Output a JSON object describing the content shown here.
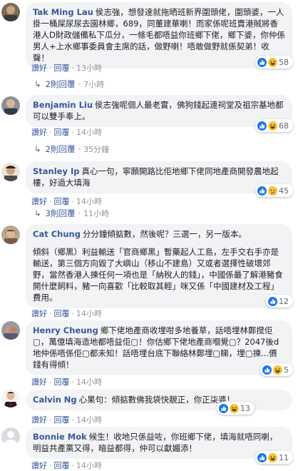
{
  "comments": [
    {
      "name": "Tak Ming Lau",
      "text": "侯志強，想發達就拖晒班新界圍頭佬，圍頭婆，一人掛一桶屎尿尿去園林鄉，689，同董建華喇！而家係呢班賣港賊將香港人D財政儲備私下瓜分，一條毛都唔益你班鄉下佬，鄉下婆，你仲係男人+上水鄉事委員會主席的話，做野喇！唔敢做野就係契弟！收聲！",
      "actions": {
        "like": "讚好",
        "reply": "回覆",
        "time": "13小時"
      },
      "reaction_count": "58",
      "reactions": [
        "like",
        "haha"
      ],
      "replies": {
        "label": "2則回覆",
        "time": "7小時"
      }
    },
    {
      "name": "Benjamin Liu",
      "text": "侯志強呢個人最老實，佛狗錢起連祠堂及祖宗基地都可以雙手奉上。",
      "actions": {
        "like": "讚好",
        "reply": "回覆",
        "time": "14小時"
      },
      "reaction_count": "68",
      "reactions": [
        "like",
        "haha"
      ],
      "replies": {
        "label": "2則回覆",
        "time": "35分鐘"
      }
    },
    {
      "name": "Stanley Ip",
      "text": "真心一句，寧願開路比佢地鄉下佬同地產商開發農地起樓，好過大填海",
      "actions": {
        "like": "讚好",
        "reply": "回覆",
        "time": "14小時"
      },
      "reaction_count": "45",
      "reactions": [
        "like",
        "sad"
      ],
      "replies": {
        "label": "3則回覆",
        "time": "11小時"
      }
    },
    {
      "name": "Cat Chung",
      "text": "分分鐘傾掂數，然後呢？三選一，另一版本。",
      "text2": "傾斜（鄉黑）利益輸送「官商鄉黑」暫藥起人工島，左手交右手亦是輸送，第三個方向毀了大嶼山（移山不建島）又或者選擇性破壞郊野，當然香港人揀任何一項也是「納稅人的錢」，中國係最了解港豬食開什麼飼料，豬一向喜歡「比較取其輕」咪又係「中國建材及工程」費用。",
      "actions": {
        "like": "讚好",
        "reply": "回覆",
        "time": "14小時"
      },
      "reaction_count": "12",
      "reactions": [
        "like"
      ]
    },
    {
      "name": "Henry Cheung",
      "text": "鄉下佬地產商收埋咁多地養草，話唔埋林鄭搅佢▢，萬億填海造地都唔益佢▢！你估鄉下佬地產商嗰覺▢？2047後d地仲係唔係佢▢都未知！話唔埋台底下聯絡林鄭埋▢睇，埋▢揀...價錢有得傾！",
      "actions": {
        "like": "讚好",
        "reply": "回覆",
        "time": "14小時"
      },
      "reaction_count": "5",
      "reactions": [
        "like",
        "haha"
      ]
    },
    {
      "name": "Calvin Ng",
      "text": "心果句：傾掂數佛我袋快靚正，你正柒婆！",
      "actions": {
        "like": "讚好",
        "reply": "回覆",
        "time": "14小時"
      },
      "reaction_count": "13",
      "reactions": [
        "like",
        "haha"
      ]
    },
    {
      "name": "Bonnie Mok",
      "text": "候生！收地只係益咗，你班鄉下佬，填海就唔同喇，明益共產黨又得，暗益都得，仲可以獻媚添！",
      "actions": {
        "like": "讚好",
        "reply": "回覆",
        "time": "14小時"
      },
      "reaction_count": "11",
      "reactions": [
        "like",
        "haha"
      ]
    }
  ],
  "colors": {
    "name": "#385898",
    "bubble": "#f2f3f5",
    "like": "#1877f2",
    "haha": "#f7c33a",
    "meta": "#606770"
  }
}
